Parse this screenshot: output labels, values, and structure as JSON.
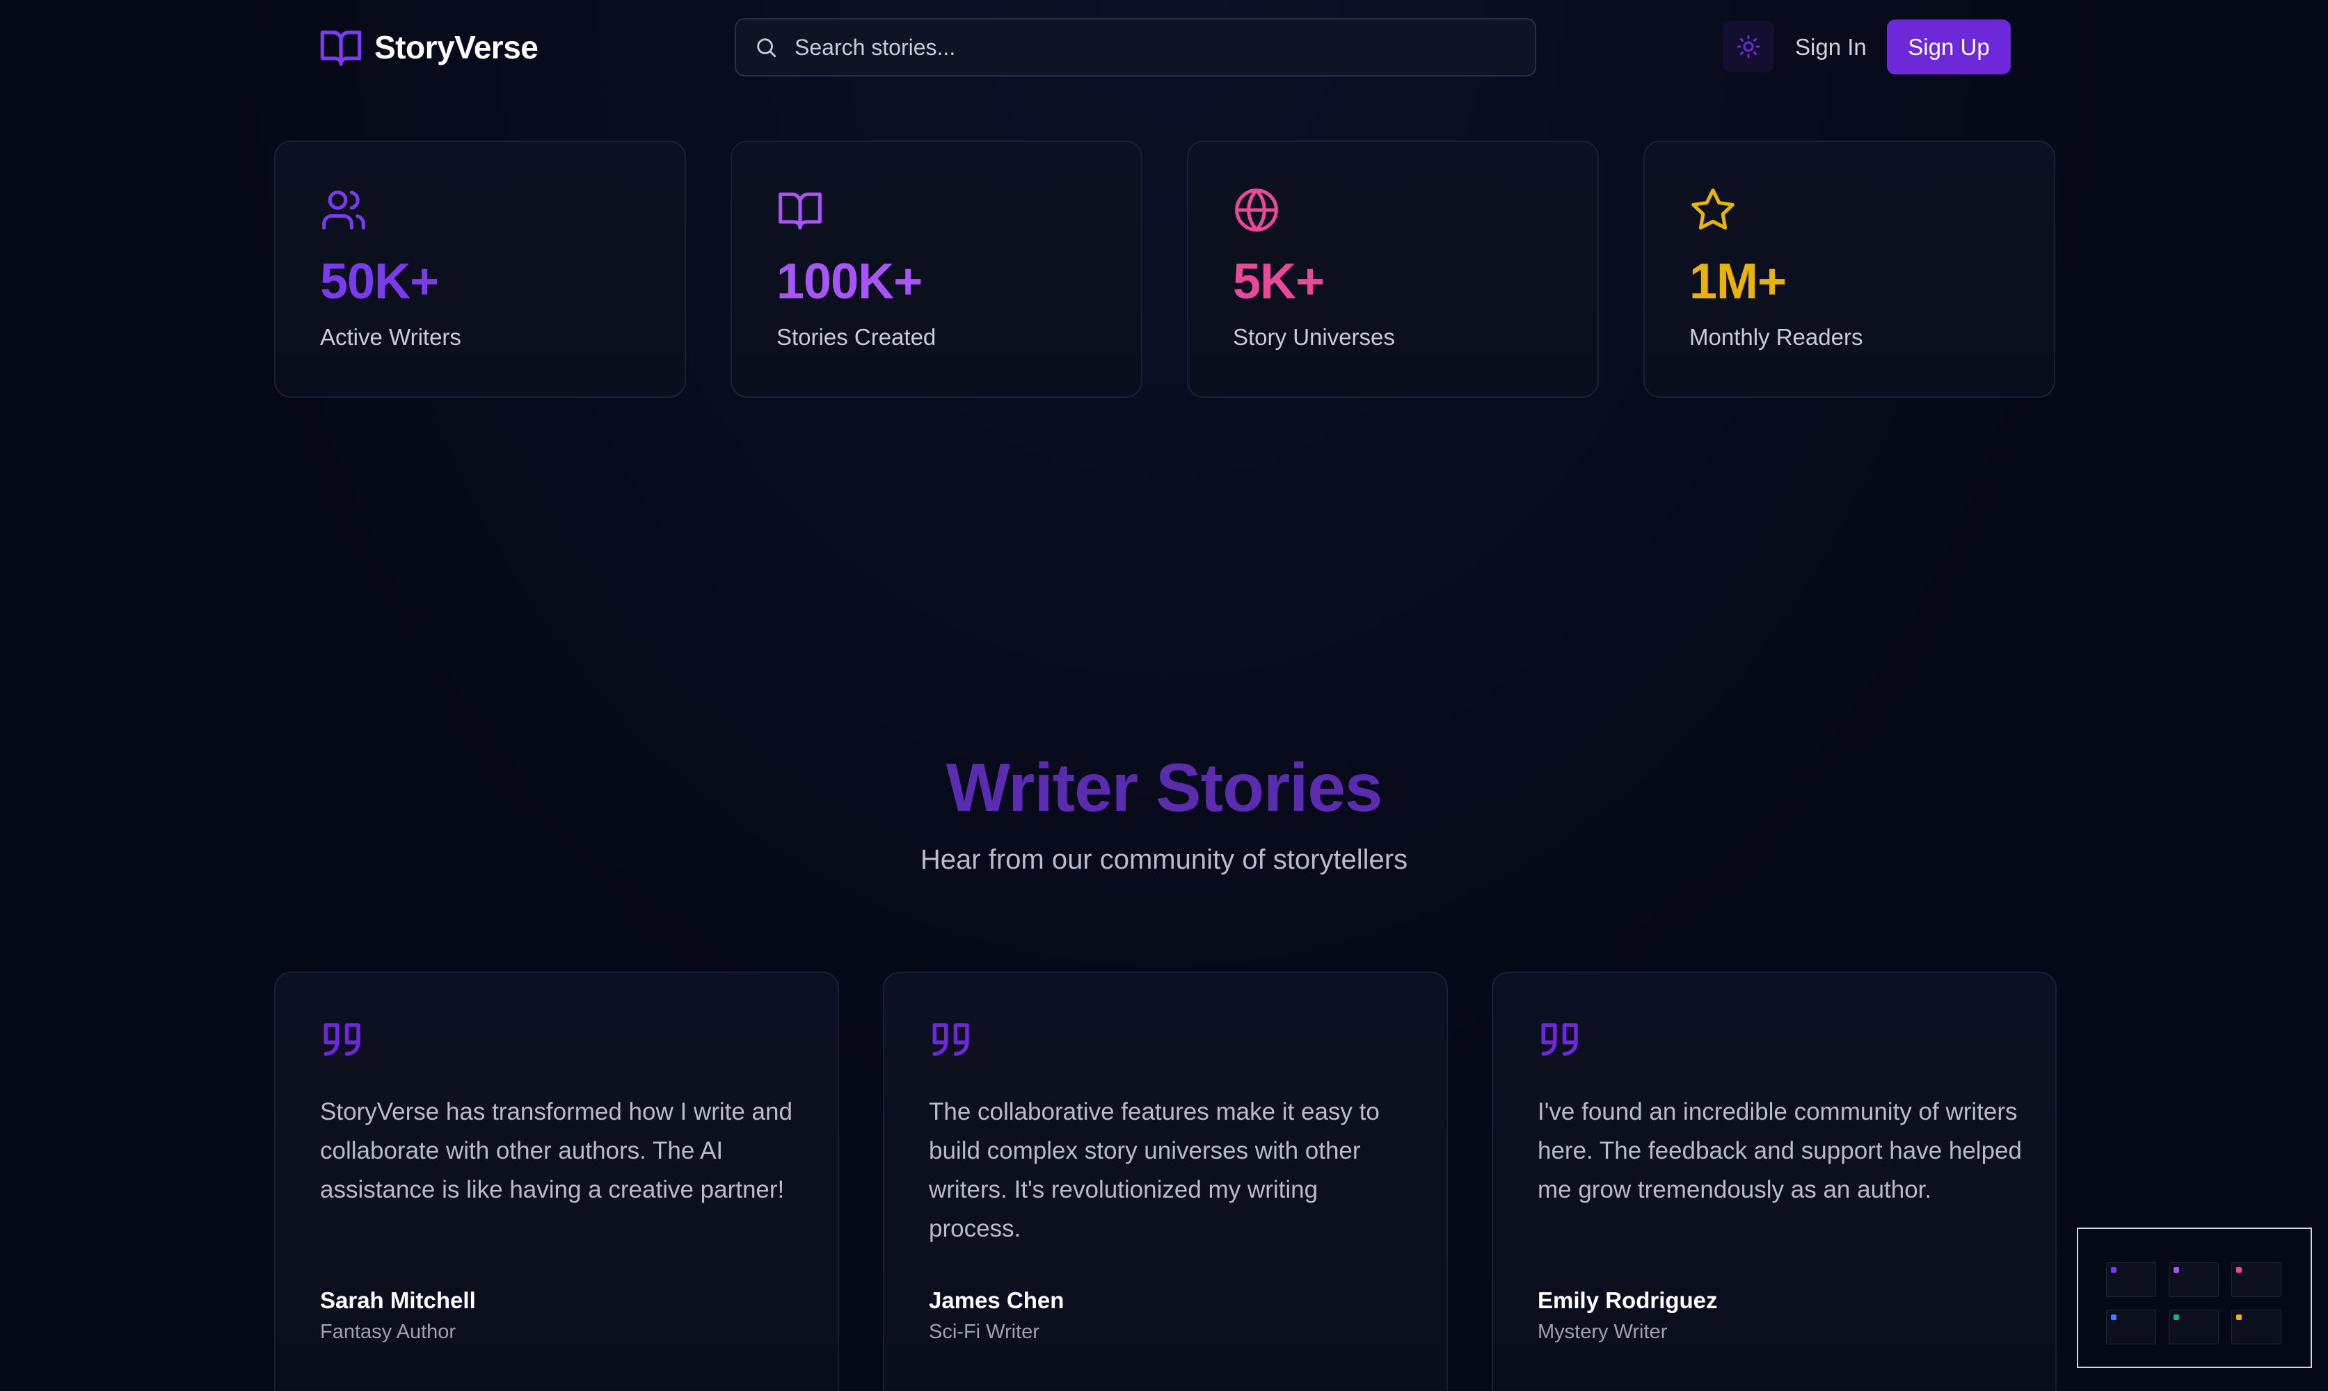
{
  "header": {
    "brand": "StoryVerse",
    "search_placeholder": "Search stories...",
    "sign_in_label": "Sign In",
    "sign_up_label": "Sign Up"
  },
  "stats": [
    {
      "value": "50K+",
      "label": "Active Writers",
      "icon": "users-icon",
      "color": "#7c3aed"
    },
    {
      "value": "100K+",
      "label": "Stories Created",
      "icon": "book-open-icon",
      "color": "#a855f7"
    },
    {
      "value": "5K+",
      "label": "Story Universes",
      "icon": "globe-icon",
      "color": "#ec4899"
    },
    {
      "value": "1M+",
      "label": "Monthly Readers",
      "icon": "star-icon",
      "color": "#eab308"
    }
  ],
  "testimonials_section": {
    "title": "Writer Stories",
    "subtitle": "Hear from our community of storytellers"
  },
  "testimonials": [
    {
      "quote": "StoryVerse has transformed how I write and collaborate with other authors. The AI assistance is like having a creative partner!",
      "name": "Sarah Mitchell",
      "role": "Fantasy Author"
    },
    {
      "quote": "The collaborative features make it easy to build complex story universes with other writers. It's revolutionized my writing process.",
      "name": "James Chen",
      "role": "Sci-Fi Writer"
    },
    {
      "quote": "I've found an incredible community of writers here. The feedback and support have helped me grow tremendously as an author.",
      "name": "Emily Rodriguez",
      "role": "Mystery Writer"
    }
  ],
  "colors": {
    "accent": "#6d28d9",
    "background": "#050816",
    "quote_icon": "#6d28d9"
  }
}
